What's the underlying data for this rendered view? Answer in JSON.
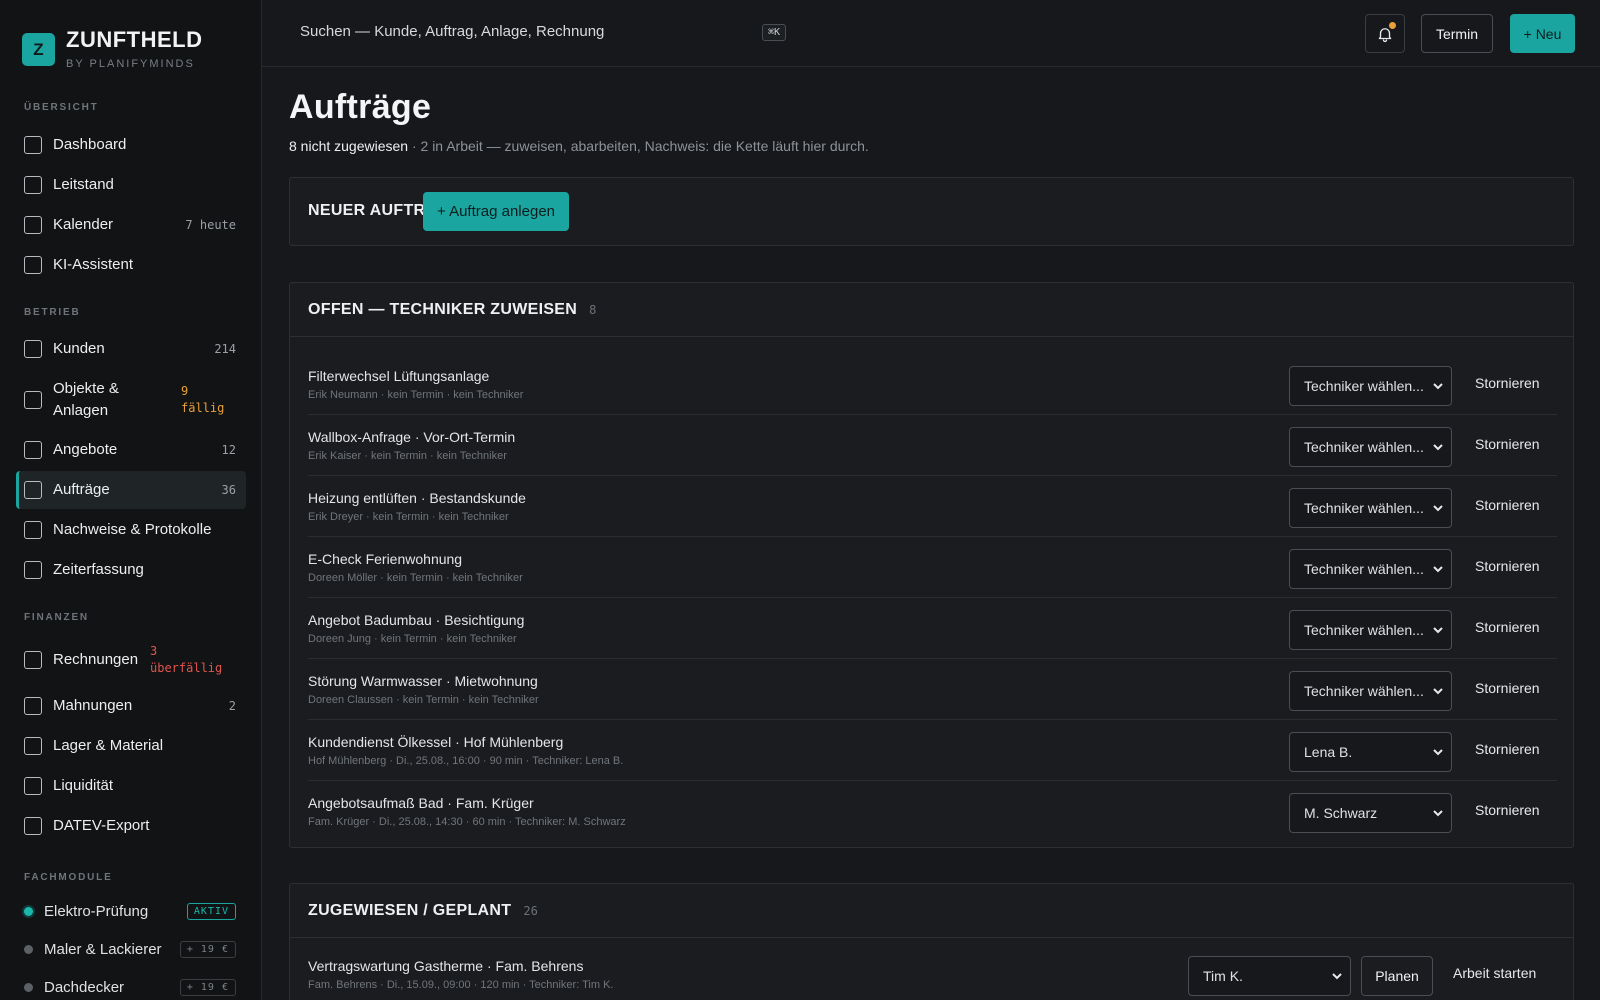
{
  "brand": {
    "logo_letter": "Z",
    "name": "ZUNFTHELD",
    "sub": "BY PLANIFYMINDS"
  },
  "sidebar": {
    "sections": [
      {
        "label": "ÜBERSICHT"
      },
      {
        "label": "BETRIEB"
      },
      {
        "label": "FINANZEN"
      },
      {
        "label": "FACHMODULE"
      }
    ],
    "items": [
      {
        "label": "Dashboard",
        "count": ""
      },
      {
        "label": "Leitstand",
        "count": ""
      },
      {
        "label": "Kalender",
        "count": "7 heute"
      },
      {
        "label": "KI-Assistent",
        "count": ""
      },
      {
        "label": "Kunden",
        "count": "214"
      },
      {
        "label": "Objekte &",
        "label2": "Anlagen",
        "count": "9",
        "count2": "fällig"
      },
      {
        "label": "Angebote",
        "count": "12"
      },
      {
        "label": "Aufträge",
        "count": "36"
      },
      {
        "label": "Nachweise & Protokolle",
        "count": ""
      },
      {
        "label": "Zeiterfassung",
        "count": ""
      },
      {
        "label": "Rechnungen",
        "count": "3",
        "count2": "überfällig"
      },
      {
        "label": "Mahnungen",
        "count": "2"
      },
      {
        "label": "Lager & Material",
        "count": ""
      },
      {
        "label": "Liquidität",
        "count": ""
      },
      {
        "label": "DATEV-Export",
        "count": ""
      }
    ],
    "modules": [
      {
        "label": "Elektro-Prüfung",
        "badge": "AKTIV"
      },
      {
        "label": "Maler & Lackierer",
        "badge": "+ 19 €"
      },
      {
        "label": "Dachdecker",
        "badge": "+ 19 €"
      }
    ]
  },
  "topbar": {
    "search_placeholder": "Suchen — Kunde, Auftrag, Anlage, Rechnung",
    "shortcut": "⌘K",
    "termin_label": "Termin",
    "new_label": "+ Neu"
  },
  "page": {
    "title": "Aufträge",
    "sub_strong": "8 nicht zugewiesen",
    "sub_rest": " · 2 in Arbeit — zuweisen, abarbeiten, Nachweis: die Kette läuft hier durch."
  },
  "new_order": {
    "title": "NEUER AUFTRAG",
    "button": "+ Auftrag anlegen"
  },
  "open_panel": {
    "title": "OFFEN — TECHNIKER ZUWEISEN",
    "count": "8",
    "cancel_label": "Stornieren",
    "rows": [
      {
        "title": "Filterwechsel Lüftungsanlage",
        "meta": "Erik Neumann · kein Termin · kein Techniker",
        "select": "Techniker wählen..."
      },
      {
        "title": "Wallbox-Anfrage · Vor-Ort-Termin",
        "meta": "Erik Kaiser · kein Termin · kein Techniker",
        "select": "Techniker wählen..."
      },
      {
        "title": "Heizung entlüften · Bestandskunde",
        "meta": "Erik Dreyer · kein Termin · kein Techniker",
        "select": "Techniker wählen..."
      },
      {
        "title": "E-Check Ferienwohnung",
        "meta": "Doreen Möller · kein Termin · kein Techniker",
        "select": "Techniker wählen..."
      },
      {
        "title": "Angebot Badumbau · Besichtigung",
        "meta": "Doreen Jung · kein Termin · kein Techniker",
        "select": "Techniker wählen..."
      },
      {
        "title": "Störung Warmwasser · Mietwohnung",
        "meta": "Doreen Claussen · kein Termin · kein Techniker",
        "select": "Techniker wählen..."
      },
      {
        "title": "Kundendienst Ölkessel · Hof Mühlenberg",
        "meta": "Hof Mühlenberg · Di., 25.08., 16:00 · 90 min · Techniker: Lena B.",
        "select": "Lena B."
      },
      {
        "title": "Angebotsaufmaß Bad · Fam. Krüger",
        "meta": "Fam. Krüger · Di., 25.08., 14:30 · 60 min · Techniker: M. Schwarz",
        "select": "M. Schwarz"
      }
    ]
  },
  "assigned_panel": {
    "title": "ZUGEWIESEN / GEPLANT",
    "count": "26",
    "rows": [
      {
        "title": "Vertragswartung Gastherme · Fam. Behrens",
        "meta": "Fam. Behrens · Di., 15.09., 09:00 · 120 min · Techniker: Tim K.",
        "select": "Tim K.",
        "plan_label": "Planen",
        "start_label": "Arbeit starten"
      }
    ]
  }
}
